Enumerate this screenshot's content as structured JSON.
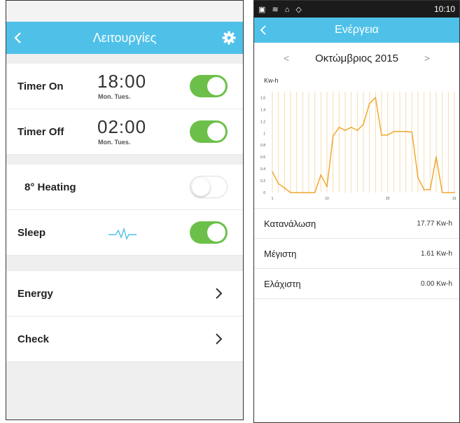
{
  "left_screen": {
    "header": {
      "title": "Λειτουργίες",
      "back_icon": "chevron-left-icon",
      "settings_icon": "gear-icon"
    },
    "timer_on": {
      "label": "Timer On",
      "time": "18:00",
      "days": "Mon. Tues.",
      "enabled": true
    },
    "timer_off": {
      "label": "Timer Off",
      "time": "02:00",
      "days": "Mon. Tues.",
      "enabled": true
    },
    "heating": {
      "label": "8° Heating",
      "enabled": false
    },
    "sleep": {
      "label": "Sleep",
      "icon": "sleep-wave-icon",
      "enabled": true
    },
    "energy": {
      "label": "Energy",
      "icon": "chevron-right-icon"
    },
    "check": {
      "label": "Check",
      "icon": "chevron-right-icon"
    }
  },
  "right_screen": {
    "status_bar": {
      "icons": "▣ ≋ ⌂ ◇",
      "time": "10:10"
    },
    "header": {
      "title": "Ενέργεια",
      "back_icon": "chevron-left-icon"
    },
    "month_nav": {
      "prev": "<",
      "label": "Οκτώμβριος 2015",
      "next": ">"
    },
    "unit_label": "Kw-h",
    "stats": [
      {
        "label": "Κατανάλωση",
        "value": "17.77 Kw-h"
      },
      {
        "label": "Μέγιστη",
        "value": "1.61 Kw-h"
      },
      {
        "label": "Ελάχιστη",
        "value": "0.00 Kw-h"
      }
    ]
  },
  "chart_data": {
    "type": "line",
    "x": [
      1,
      2,
      3,
      4,
      5,
      6,
      7,
      8,
      9,
      10,
      11,
      12,
      13,
      14,
      15,
      16,
      17,
      18,
      19,
      20,
      21,
      22,
      23,
      24,
      25,
      26,
      27,
      28,
      29,
      30,
      31
    ],
    "values": [
      0.35,
      0.15,
      0.08,
      0,
      0,
      0,
      0,
      0,
      0.3,
      0.1,
      0.95,
      1.1,
      1.05,
      1.1,
      1.05,
      1.15,
      1.5,
      1.6,
      0.97,
      0.97,
      1.03,
      1.03,
      1.03,
      1.02,
      0.25,
      0.05,
      0.05,
      0.6,
      0,
      0,
      0
    ],
    "x_ticks": [
      "1",
      "10",
      "20",
      "31"
    ],
    "y_ticks": [
      "0",
      "0.2",
      "0.4",
      "0.6",
      "0.8",
      "1",
      "1.2",
      "1.4",
      "1.6"
    ],
    "ylim": [
      0,
      1.7
    ],
    "xlim": [
      1,
      31
    ],
    "ylabel": "Kw-h",
    "grid": true,
    "line_color": "#f0a830",
    "grid_color": "#f5ddb0"
  }
}
